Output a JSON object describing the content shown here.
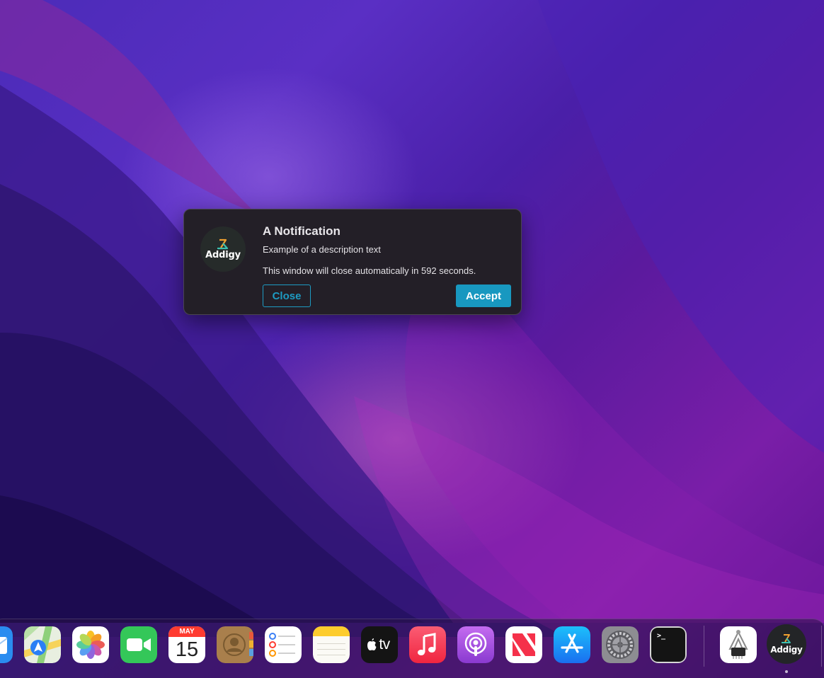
{
  "notification": {
    "title": "A Notification",
    "description": "Example of a description text",
    "countdown_text": "This window will close automatically in 592 seconds.",
    "logo_text": "Addigy",
    "close_label": "Close",
    "accept_label": "Accept",
    "accent_color": "#1898c0",
    "background_color": "#231f27"
  },
  "dock": {
    "items": [
      {
        "name": "Mail",
        "icon": "mail-icon"
      },
      {
        "name": "Maps",
        "icon": "maps-icon"
      },
      {
        "name": "Photos",
        "icon": "photos-icon"
      },
      {
        "name": "FaceTime",
        "icon": "facetime-icon"
      },
      {
        "name": "Calendar",
        "icon": "calendar-icon",
        "month": "MAY",
        "day": "15"
      },
      {
        "name": "Contacts",
        "icon": "contacts-icon"
      },
      {
        "name": "Reminders",
        "icon": "reminders-icon"
      },
      {
        "name": "Notes",
        "icon": "notes-icon"
      },
      {
        "name": "TV",
        "icon": "apple-tv-icon",
        "label": "tv"
      },
      {
        "name": "Music",
        "icon": "music-icon"
      },
      {
        "name": "Podcasts",
        "icon": "podcasts-icon"
      },
      {
        "name": "News",
        "icon": "news-icon"
      },
      {
        "name": "App Store",
        "icon": "app-store-icon"
      },
      {
        "name": "System Preferences",
        "icon": "system-preferences-icon"
      },
      {
        "name": "Terminal",
        "icon": "terminal-icon",
        "prompt": ">_"
      },
      {
        "name": "System Information",
        "icon": "system-information-icon"
      },
      {
        "name": "Addigy",
        "icon": "addigy-icon",
        "label": "Addigy",
        "running": true
      }
    ]
  }
}
